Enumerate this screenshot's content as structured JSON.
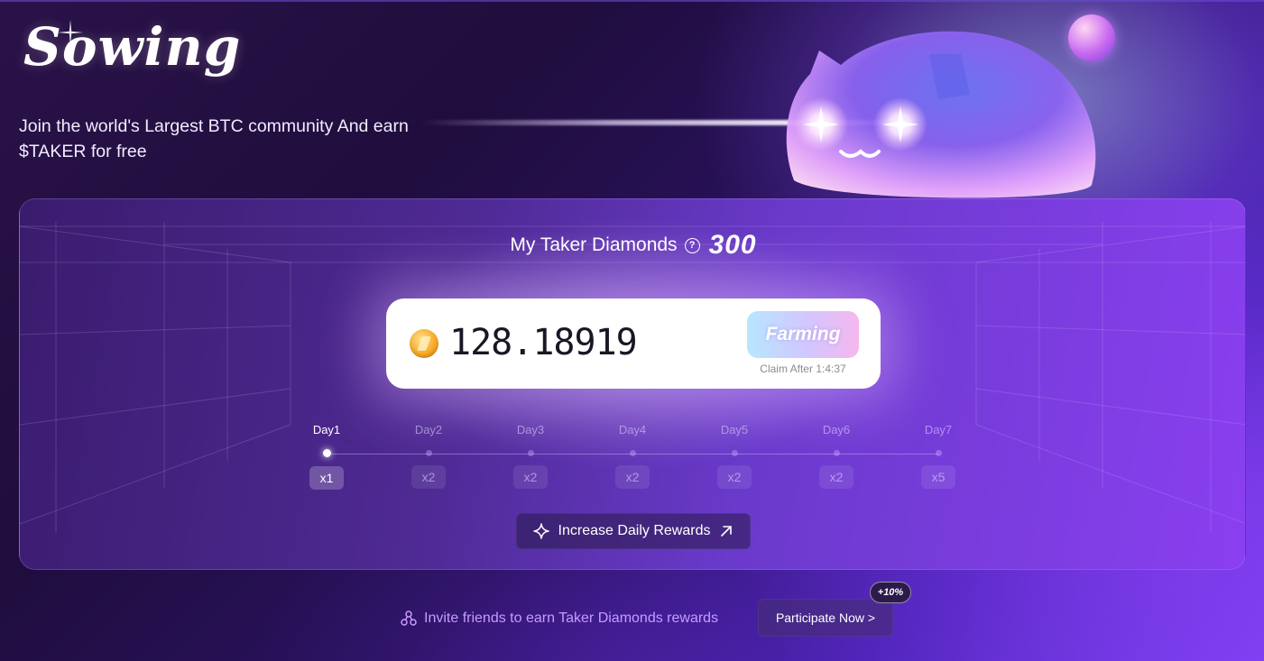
{
  "header": {
    "logo_text": "Sowing",
    "tagline": "Join the world's Largest BTC community And earn $TAKER for free"
  },
  "diamonds": {
    "title": "My Taker Diamonds",
    "help_icon": "?",
    "value": "300"
  },
  "balance": {
    "value": "128.18919",
    "farming_label": "Farming",
    "claim_text": "Claim After 1:4:37"
  },
  "days": [
    {
      "label": "Day1",
      "multiplier": "x1",
      "active": true
    },
    {
      "label": "Day2",
      "multiplier": "x2",
      "active": false
    },
    {
      "label": "Day3",
      "multiplier": "x2",
      "active": false
    },
    {
      "label": "Day4",
      "multiplier": "x2",
      "active": false
    },
    {
      "label": "Day5",
      "multiplier": "x2",
      "active": false
    },
    {
      "label": "Day6",
      "multiplier": "x2",
      "active": false
    },
    {
      "label": "Day7",
      "multiplier": "x5",
      "active": false
    }
  ],
  "increase_button": {
    "label": "Increase Daily Rewards",
    "left_icon": "sparkle-icon",
    "right_icon": "arrow-up-right-icon"
  },
  "invite": {
    "text": "Invite friends to earn Taker Diamonds rewards",
    "icon": "share-nodes-icon",
    "button_label": "Participate Now >",
    "bonus_badge": "+10%"
  },
  "colors": {
    "accent_purple": "#8a3ff0",
    "invite_text": "#c79bff",
    "balance_box": "#ffffff"
  }
}
